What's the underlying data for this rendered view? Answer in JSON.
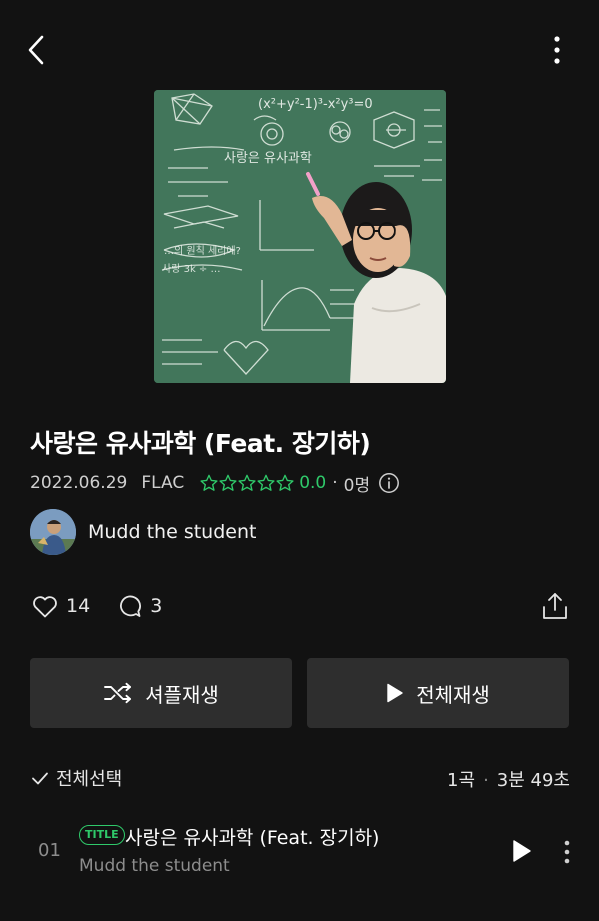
{
  "album": {
    "title": "사랑은 유사과학 (Feat. 장기하)",
    "release_date": "2022.06.29",
    "format": "FLAC",
    "rating": "0.0",
    "rating_count": "0명"
  },
  "artist": {
    "name": "Mudd the student"
  },
  "actions": {
    "likes": "14",
    "comments": "3"
  },
  "buttons": {
    "shuffle": "셔플재생",
    "play_all": "전체재생"
  },
  "list": {
    "select_all": "전체선택",
    "track_count": "1곡",
    "total_time": "3분 49초"
  },
  "tracks": [
    {
      "number": "01",
      "badge": "TITLE",
      "title": "사랑은 유사과학 (Feat. 장기하)",
      "artist": "Mudd the student"
    }
  ],
  "colors": {
    "accent_green": "#2fc96a",
    "background": "#121212",
    "button_bg": "#2e2e2e"
  },
  "cover_art_text": {
    "equation": "(x²+y²-1)³-x²y³=0",
    "heading": "사랑은 유사과학",
    "question": "…의 원칙 세리에?",
    "note": "사랑 3k ÷ …"
  }
}
